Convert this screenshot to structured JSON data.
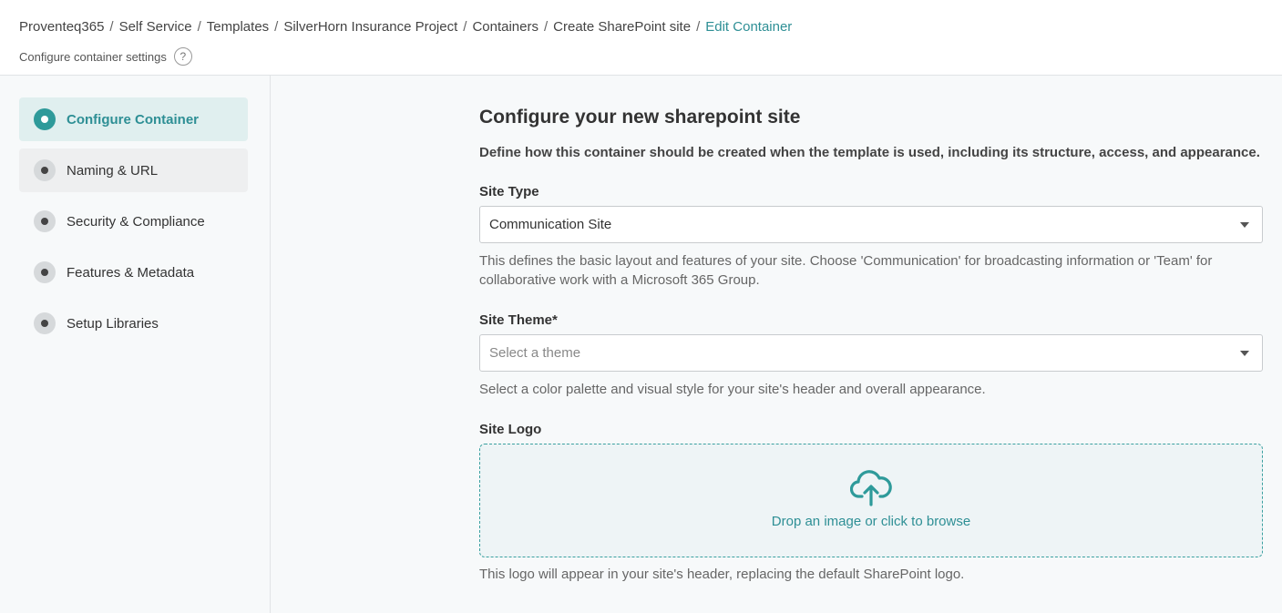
{
  "breadcrumb": {
    "items": [
      "Proventeq365",
      "Self Service",
      "Templates",
      "SilverHorn Insurance Project",
      "Containers",
      "Create SharePoint site"
    ],
    "current": "Edit Container",
    "separator": "/"
  },
  "header": {
    "subtitle": "Configure container settings",
    "help_glyph": "?"
  },
  "sidebar": {
    "steps": [
      {
        "label": "Configure Container",
        "state": "active"
      },
      {
        "label": "Naming & URL",
        "state": "hover"
      },
      {
        "label": "Security & Compliance",
        "state": "pending"
      },
      {
        "label": "Features & Metadata",
        "state": "pending"
      },
      {
        "label": "Setup Libraries",
        "state": "pending"
      }
    ]
  },
  "main": {
    "title": "Configure your new sharepoint site",
    "description": "Define how this container should be created when the template is used, including its structure, access, and appearance.",
    "site_type": {
      "label": "Site Type",
      "value": "Communication Site",
      "hint": "This defines the basic layout and features of your site. Choose 'Communication' for broadcasting information or 'Team' for collaborative work with a Microsoft 365 Group."
    },
    "site_theme": {
      "label": "Site Theme*",
      "placeholder": "Select a theme",
      "hint": "Select a color palette and visual style for your site's header and overall appearance."
    },
    "site_logo": {
      "label": "Site Logo",
      "dropzone_text": "Drop an image or click to browse",
      "dropzone_icon": "cloud-upload-icon",
      "hint": "This logo will appear in your site's header, replacing the default SharePoint logo."
    }
  },
  "colors": {
    "accent": "#2e8f95",
    "active_bg": "#e0efef"
  }
}
